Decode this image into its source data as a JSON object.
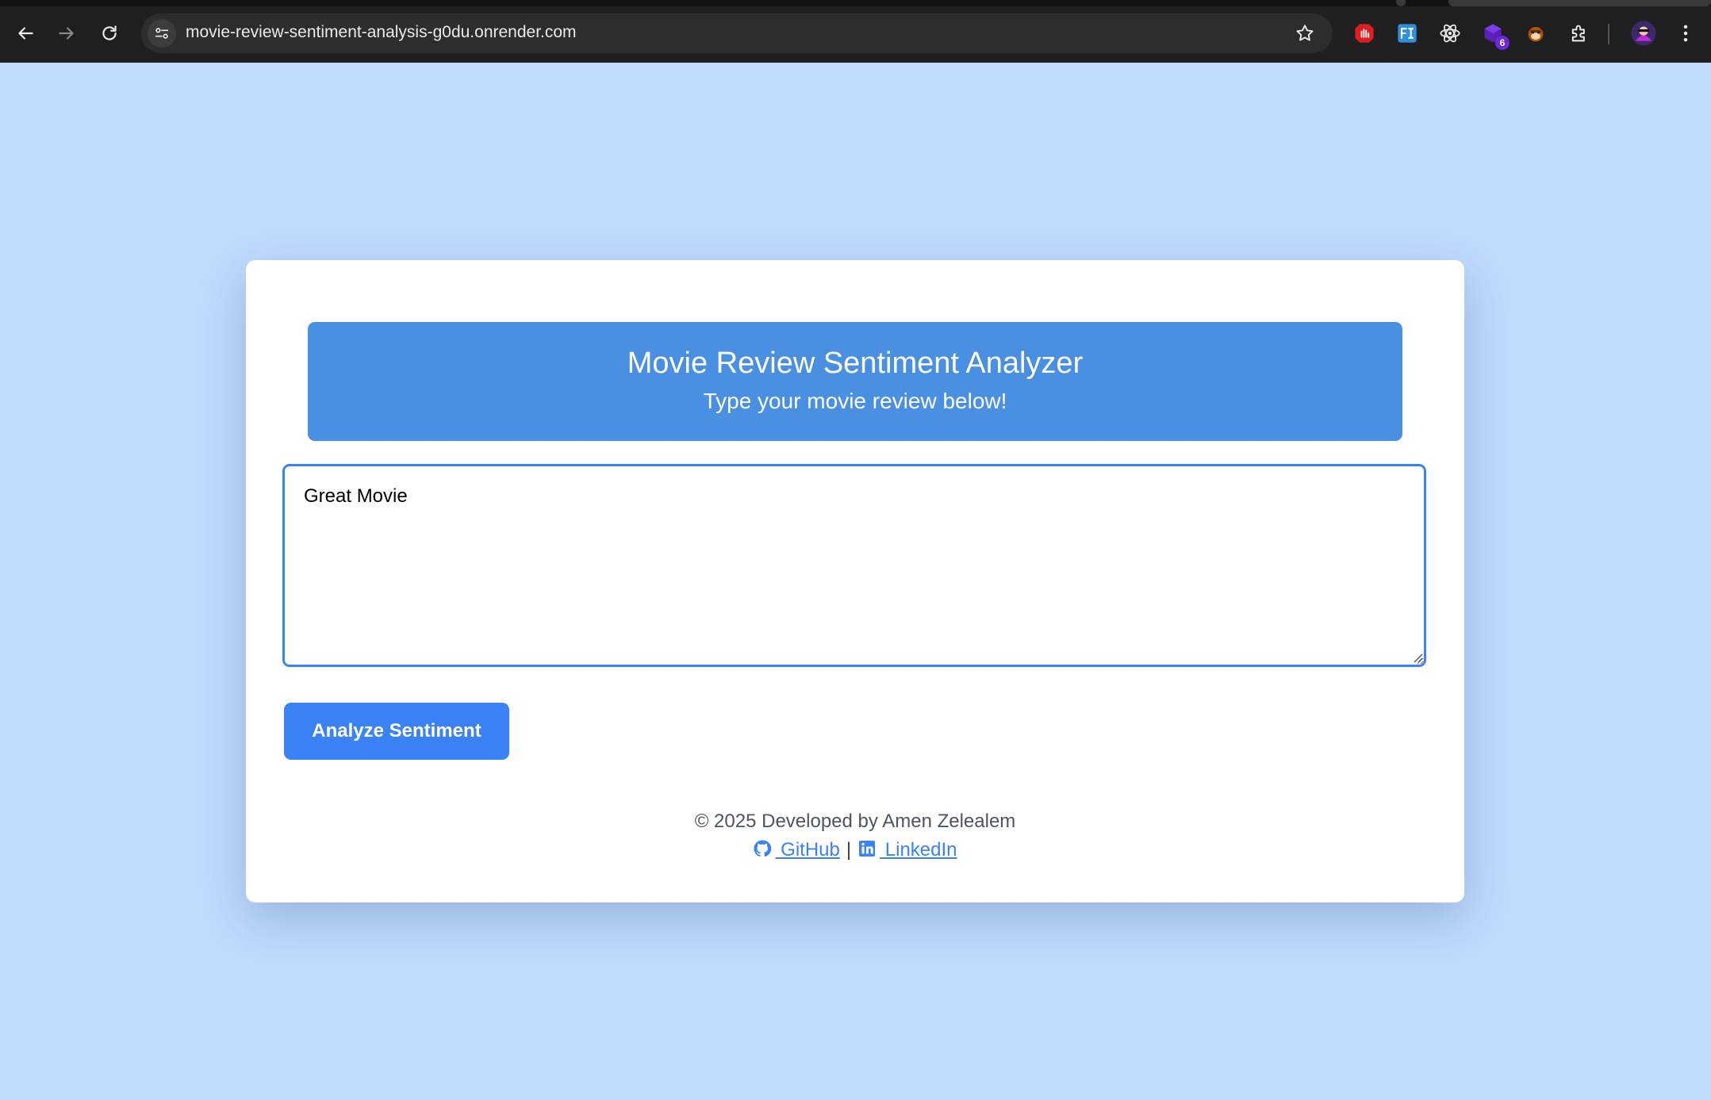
{
  "browser": {
    "url": "movie-review-sentiment-analysis-g0du.onrender.com",
    "extension_badge_count": "6",
    "icons": [
      "back-icon",
      "forward-icon",
      "reload-icon",
      "site-info-icon",
      "bookmark-star-icon",
      "extensions-puzzle-icon",
      "profile-avatar",
      "menu-dots-icon"
    ]
  },
  "header": {
    "title": "Movie Review Sentiment Analyzer",
    "subtitle": "Type your movie review below!"
  },
  "review": {
    "value": "Great Movie"
  },
  "actions": {
    "analyze_label": "Analyze Sentiment"
  },
  "footer": {
    "copyright": "© 2025 Developed by Amen Zelealem",
    "github_label": " GitHub",
    "separator": "|",
    "linkedin_label": " LinkedIn"
  },
  "colors": {
    "page_background": "#bfdbfe",
    "header_background": "#4a90e2",
    "accent": "#3b82f6"
  }
}
